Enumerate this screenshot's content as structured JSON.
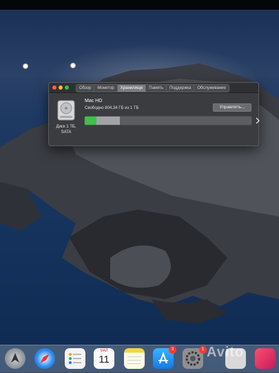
{
  "window": {
    "tabs": [
      {
        "label": "Обзор",
        "active": false
      },
      {
        "label": "Монитор",
        "active": false
      },
      {
        "label": "Хранилище",
        "active": true
      },
      {
        "label": "Память",
        "active": false
      },
      {
        "label": "Поддержка",
        "active": false
      },
      {
        "label": "Обслуживание",
        "active": false
      }
    ],
    "disk": {
      "name": "Mac HD",
      "free_text": "Свободно 804,34 ГБ из 1 ТБ",
      "label_line1": "Диск 1 ТБ,",
      "label_line2": "SATA",
      "manage_label": "Управлять...",
      "usage": {
        "green_fraction": 0.07,
        "gray_fraction": 0.14
      }
    }
  },
  "dock": {
    "calendar": {
      "month": "МАЙ",
      "day": "11"
    },
    "app_store_badge": "3",
    "settings_badge": "1"
  },
  "watermark": "Avito",
  "colors": {
    "accent_green": "#3fbf4b",
    "badge_red": "#ff3b30"
  }
}
